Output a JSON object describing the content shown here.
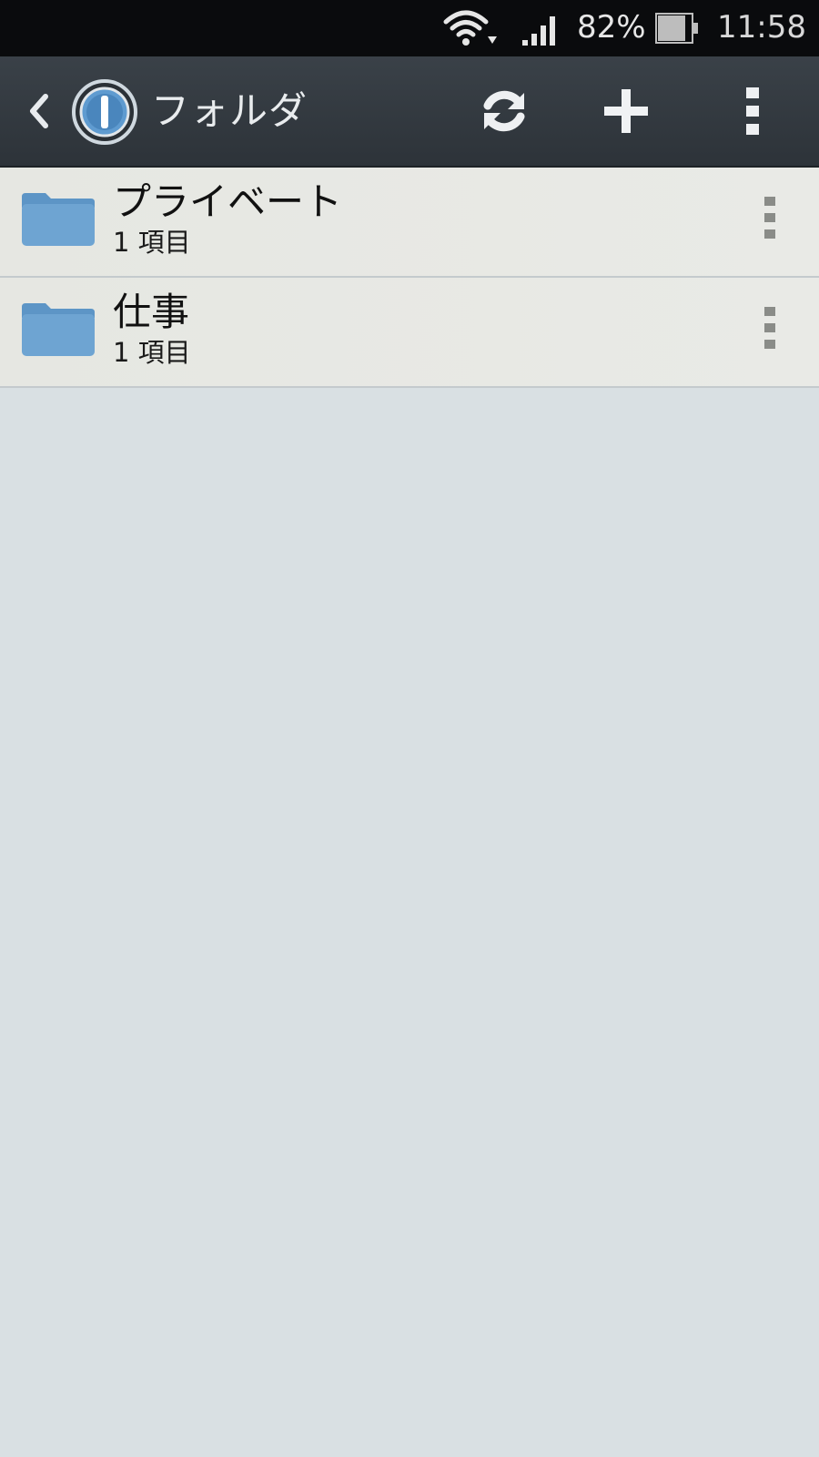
{
  "status_bar": {
    "battery_percent": "82%",
    "time": "11:58",
    "icons": [
      "wifi-icon",
      "signal-icon",
      "battery-icon"
    ]
  },
  "action_bar": {
    "title": "フォルダ",
    "icons": [
      "back-chevron-icon",
      "app-logo-icon",
      "refresh-icon",
      "add-icon",
      "overflow-menu-icon"
    ],
    "background_color": "#32393f"
  },
  "folders": [
    {
      "name": "プライベート",
      "count": "1 項目"
    },
    {
      "name": "仕事",
      "count": "1 項目"
    }
  ],
  "colors": {
    "folder_icon": "#6ea4d2",
    "list_background": "#d9e0e3"
  }
}
